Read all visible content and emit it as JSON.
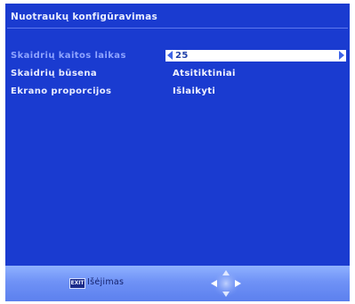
{
  "title": "Nuotraukų konfigūravimas",
  "settings": [
    {
      "label": "Skaidrių kaitos laikas",
      "value": "25",
      "selected": true
    },
    {
      "label": "Skaidrių būsena",
      "value": "Atsitiktiniai",
      "selected": false
    },
    {
      "label": "Ekrano proporcijos",
      "value": "Išlaikyti",
      "selected": false
    }
  ],
  "footer": {
    "exit_key": "EXIT",
    "exit_label": "Išėjimas"
  },
  "icons": {
    "left_arrow": "left-arrow-icon",
    "right_arrow": "right-arrow-icon",
    "nav_pad": "dpad-navigation-icon"
  },
  "colors": {
    "background": "#1a3bd0",
    "highlight_box": "#ffffff",
    "selected_label": "#8fa4ff",
    "arrow": "#3d63e8",
    "footer": "#6f92f6"
  }
}
